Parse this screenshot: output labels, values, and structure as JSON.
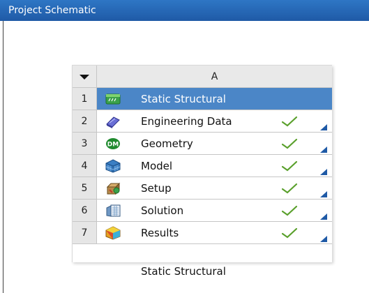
{
  "window": {
    "title": "Project Schematic"
  },
  "system": {
    "column_header": "A",
    "caption": "Static Structural",
    "rows": [
      {
        "num": "1",
        "label": "Static Structural",
        "icon": "static-structural-icon",
        "status": ""
      },
      {
        "num": "2",
        "label": "Engineering Data",
        "icon": "engineering-data-icon",
        "status": "up-to-date"
      },
      {
        "num": "3",
        "label": "Geometry",
        "icon": "geometry-dm-icon",
        "status": "up-to-date"
      },
      {
        "num": "4",
        "label": "Model",
        "icon": "model-icon",
        "status": "up-to-date"
      },
      {
        "num": "5",
        "label": "Setup",
        "icon": "setup-icon",
        "status": "up-to-date"
      },
      {
        "num": "6",
        "label": "Solution",
        "icon": "solution-icon",
        "status": "up-to-date"
      },
      {
        "num": "7",
        "label": "Results",
        "icon": "results-icon",
        "status": "up-to-date"
      }
    ]
  },
  "colors": {
    "title_bar": "#2e76c5",
    "selected_row": "#4b86c7",
    "check": "#5aa02c",
    "corner": "#1f5aa6"
  }
}
